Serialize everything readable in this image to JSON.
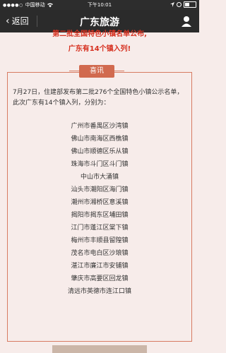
{
  "status_bar": {
    "carrier": "中国移动",
    "time": "下午10:01"
  },
  "nav": {
    "back_label": "返回",
    "title": "广东旅游"
  },
  "announcement": {
    "line1": "第二批全国特色小镇名单公布,",
    "line2": "广东有14个镇入列!"
  },
  "card": {
    "badge": "喜讯",
    "intro": "7月27日，住建部发布第二批276个全国特色小镇公示名单，此次广东有14个镇入列，分别为：",
    "towns": [
      "广州市番禺区沙湾镇",
      "佛山市南海区西樵镇",
      "佛山市顺德区乐从镇",
      "珠海市斗门区斗门镇",
      "中山市大涌镇",
      "汕头市潮阳区海门镇",
      "潮州市湘桥区意溪镇",
      "揭阳市揭东区埔田镇",
      "江门市蓬江区棠下镇",
      "梅州市丰顺县留隍镇",
      "茂名市电白区沙琅镇",
      "湛江市廉江市安铺镇",
      "肇庆市高要区回龙镇",
      "清远市英德市连江口镇"
    ]
  },
  "colors": {
    "accent_red": "#d6301f",
    "card_border": "#d77b62",
    "badge_bg": "#d16a4f",
    "page_bg": "#f7ecea",
    "nav_bg": "#2b2b2b"
  }
}
